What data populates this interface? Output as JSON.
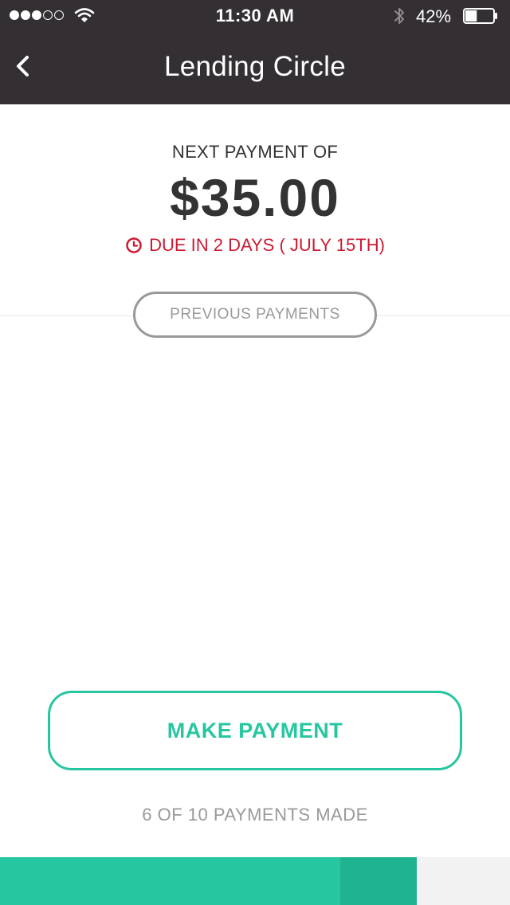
{
  "status_bar": {
    "time": "11:30 AM",
    "battery_percent": "42%",
    "battery_level": 0.42,
    "signal_bars_filled": 3,
    "signal_bars_total": 5
  },
  "nav": {
    "title": "Lending Circle",
    "back_icon": "chevron-left-icon"
  },
  "payment": {
    "label": "NEXT PAYMENT OF",
    "amount": "$35.00",
    "due": "DUE IN 2 DAYS ( JULY 15TH)",
    "due_icon": "clock-icon"
  },
  "buttons": {
    "previous_payments": "PREVIOUS PAYMENTS",
    "make_payment": "MAKE PAYMENT"
  },
  "progress": {
    "label": "6 OF 10 PAYMENTS MADE",
    "made": 6,
    "total": 10,
    "current_payment_index": 7
  },
  "colors": {
    "header_bg": "#342f33",
    "accent": "#26c7a0",
    "accent_dark": "#1fb38f",
    "due_red": "#cc1a33",
    "muted": "#999999"
  }
}
